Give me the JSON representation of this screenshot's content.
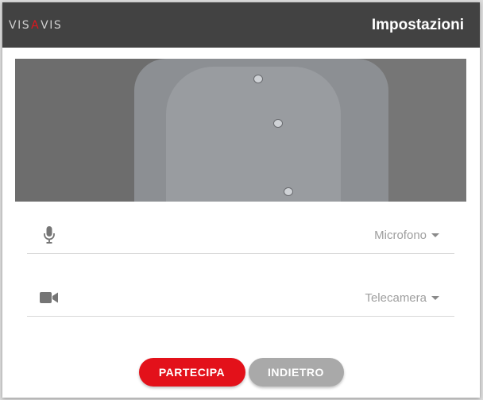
{
  "header": {
    "logo_left": "VIS",
    "logo_mark": "A",
    "logo_right": "VIS",
    "title": "Impostazioni"
  },
  "preview": {
    "description": "camera-preview"
  },
  "microphone": {
    "icon": "microphone-icon",
    "value": "Microfono"
  },
  "camera": {
    "icon": "video-camera-icon",
    "value": "Telecamera"
  },
  "actions": {
    "join_label": "PARTECIPA",
    "back_label": "INDIETRO"
  },
  "colors": {
    "header_bg": "#424242",
    "accent": "#e3111a",
    "secondary_button": "#a9a9a9"
  }
}
